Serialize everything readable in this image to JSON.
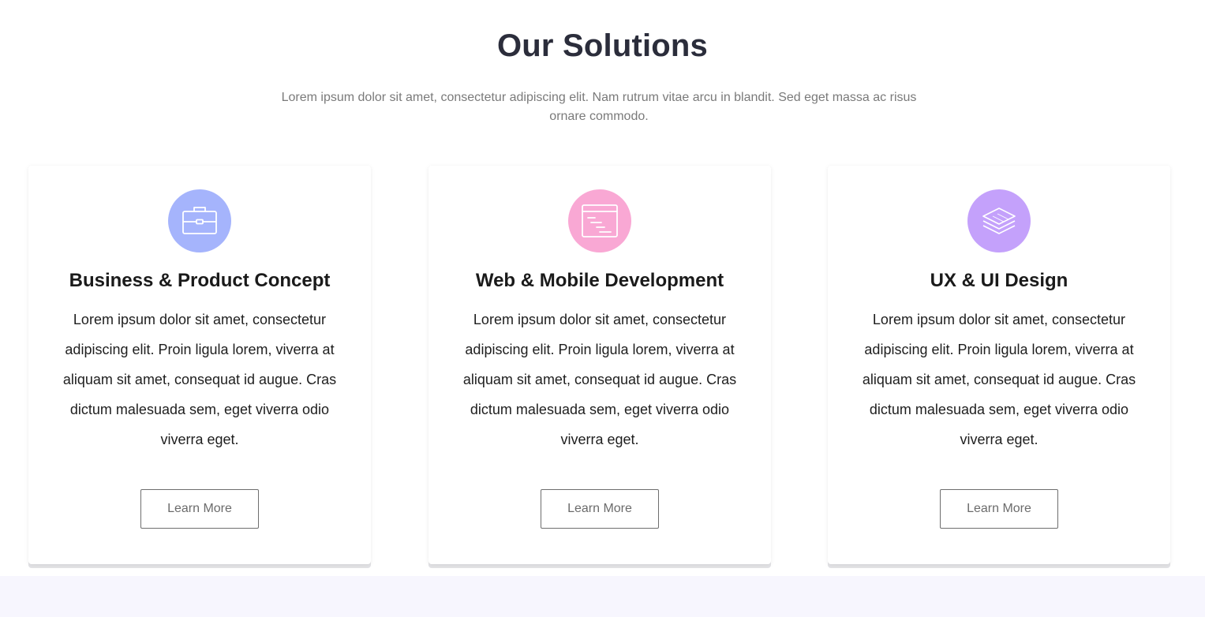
{
  "section": {
    "title": "Our Solutions",
    "subtitle": "Lorem ipsum dolor sit amet, consectetur adipiscing elit. Nam rutrum vitae arcu in blandit. Sed eget massa ac risus ornare commodo."
  },
  "cards": [
    {
      "icon": "briefcase-icon",
      "icon_color": "#a5b4fc",
      "title": "Business & Product Concept",
      "text": "Lorem ipsum dolor sit amet, consectetur adipiscing elit. Proin ligula lorem, viverra at aliquam sit amet, consequat id augue. Cras dictum malesuada sem, eget viverra odio viverra eget.",
      "button_label": "Learn More"
    },
    {
      "icon": "browser-code-icon",
      "icon_color": "#f9a8d4",
      "title": "Web & Mobile Development",
      "text": "Lorem ipsum dolor sit amet, consectetur adipiscing elit. Proin ligula lorem, viverra at aliquam sit amet, consequat id augue. Cras dictum malesuada sem, eget viverra odio viverra eget.",
      "button_label": "Learn More"
    },
    {
      "icon": "layers-icon",
      "icon_color": "#c4a1fb",
      "title": "UX & UI Design",
      "text": "Lorem ipsum dolor sit amet, consectetur adipiscing elit. Proin ligula lorem, viverra at aliquam sit amet, consequat id augue. Cras dictum malesuada sem, eget viverra odio viverra eget.",
      "button_label": "Learn More"
    }
  ]
}
